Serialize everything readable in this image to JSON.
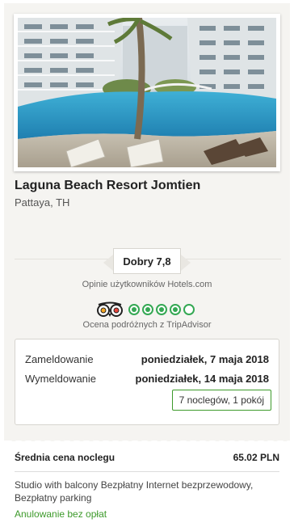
{
  "hotel": {
    "name": "Laguna Beach Resort Jomtien",
    "location": "Pattaya, TH",
    "photo_icon": "hotel-photo"
  },
  "rating": {
    "label": "Dobry 7,8",
    "hotels_caption": "Opinie użytkowników Hotels.com",
    "tripadvisor_icon": "tripadvisor-owl-icon",
    "tripadvisor_bubbles_filled": 4,
    "tripadvisor_bubbles_total": 5,
    "tripadvisor_caption": "Ocena podróżnych z TripAdvisor"
  },
  "stay": {
    "checkin_label": "Zameldowanie",
    "checkin_value": "poniedziałek, 7 maja 2018",
    "checkout_label": "Wymeldowanie",
    "checkout_value": "poniedziałek, 14 maja 2018",
    "summary": "7 noclegów, 1 pokój"
  },
  "price": {
    "label": "Średnia cena noclegu",
    "value": "65.02 PLN"
  },
  "room": {
    "description": "Studio with balcony Bezpłatny Internet bezprzewodowy, Bezpłatny parking",
    "cancellation": "Anulowanie bez opłat"
  },
  "colors": {
    "accent_green": "#3d9a2b",
    "tripadvisor_green": "#34a853",
    "card_bg": "#f5f4f1"
  }
}
